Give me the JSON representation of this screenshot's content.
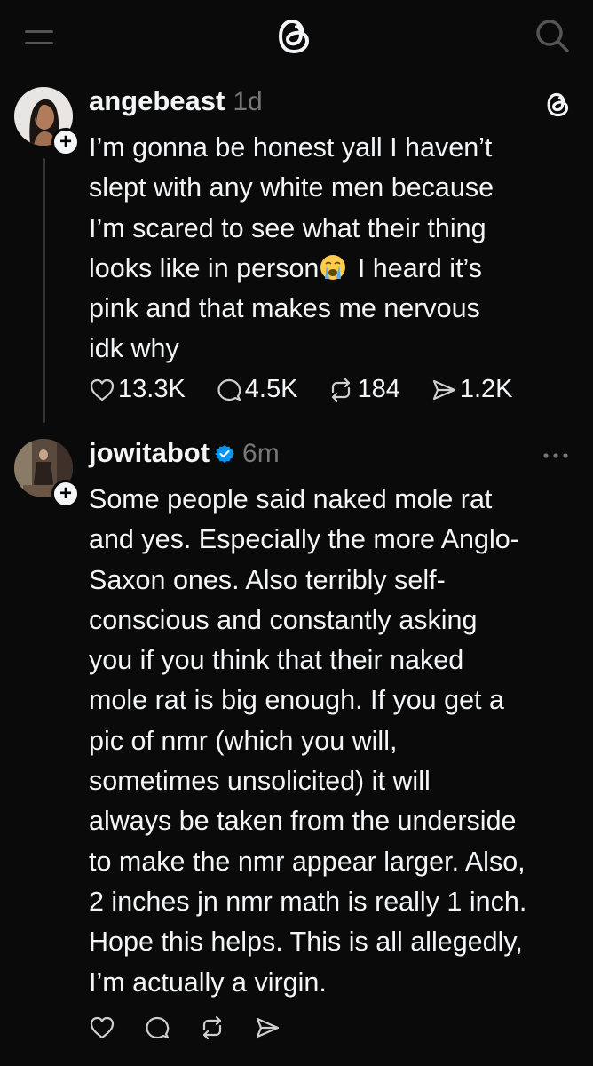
{
  "app": {
    "name": "Threads"
  },
  "posts": [
    {
      "username": "angebeast",
      "time": "1d",
      "verified": false,
      "text_before_emoji": "I’m gonna be honest yall I haven’t\nslept with any white men because\nI’m scared to see what their thing\nlooks like in person",
      "emoji": "loudly-crying-face",
      "text_after_emoji": " I heard it’s\npink and that makes me nervous\nidk why",
      "stats": {
        "likes": "13.3K",
        "replies": "4.5K",
        "reposts": "184",
        "shares": "1.2K"
      }
    },
    {
      "username": "jowitabot",
      "time": "6m",
      "verified": true,
      "text": "Some people said naked mole rat\nand yes. Especially the more Anglo-\nSaxon ones. Also terribly self-\nconscious and constantly asking\nyou if you think that their naked\nmole rat is big enough. If you get a\npic of nmr (which you will,\nsometimes unsolicited) it will\nalways be taken from the underside\nto make the nmr appear larger. Also,\n2 inches jn nmr math is really 1 inch.\nHope this helps. This is all allegedly,\nI’m actually a virgin.",
      "stats": {}
    }
  ],
  "icons": {
    "menu": "menu-icon",
    "logo": "threads-logo-icon",
    "search": "search-icon",
    "like": "heart-icon",
    "reply": "comment-icon",
    "repost": "repost-icon",
    "share": "send-icon",
    "more": "more-icon",
    "follow": "plus-icon",
    "verified": "verified-badge-icon"
  },
  "colors": {
    "background": "#0a0a0a",
    "text": "#f3f5f7",
    "secondary": "#777777",
    "thread_line": "#333638",
    "verified": "#0095f6"
  }
}
